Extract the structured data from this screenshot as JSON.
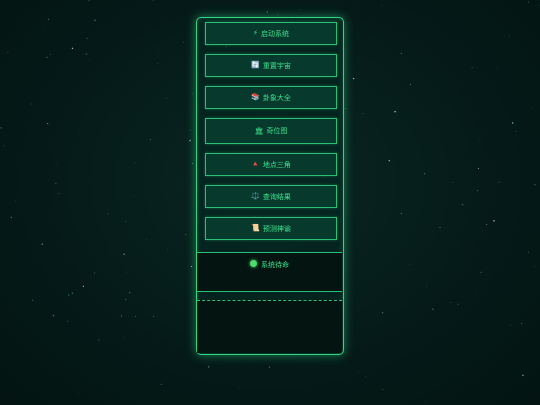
{
  "menu": {
    "items": [
      {
        "icon": "⚡",
        "icon_name": "lightning-icon",
        "label": "启动系统"
      },
      {
        "icon": "🔄",
        "icon_name": "refresh-icon",
        "label": "重置宇宙"
      },
      {
        "icon": "📚",
        "icon_name": "books-icon",
        "label": "卦象大全"
      },
      {
        "icon": "🏛",
        "icon_name": "temple-icon",
        "label": "奇位图"
      },
      {
        "icon": "🔺",
        "icon_name": "triangle-icon",
        "label": "地点三角"
      },
      {
        "icon": "⚖️",
        "icon_name": "scales-icon",
        "label": "查询结果"
      },
      {
        "icon": "📜",
        "icon_name": "scroll-icon",
        "label": "预测神谕"
      }
    ]
  },
  "status": {
    "label": "系统待命",
    "indicator_color": "#4ddc6a"
  },
  "theme": {
    "accent": "#2fd684",
    "text": "#3ee48f",
    "background": "#041a18"
  }
}
